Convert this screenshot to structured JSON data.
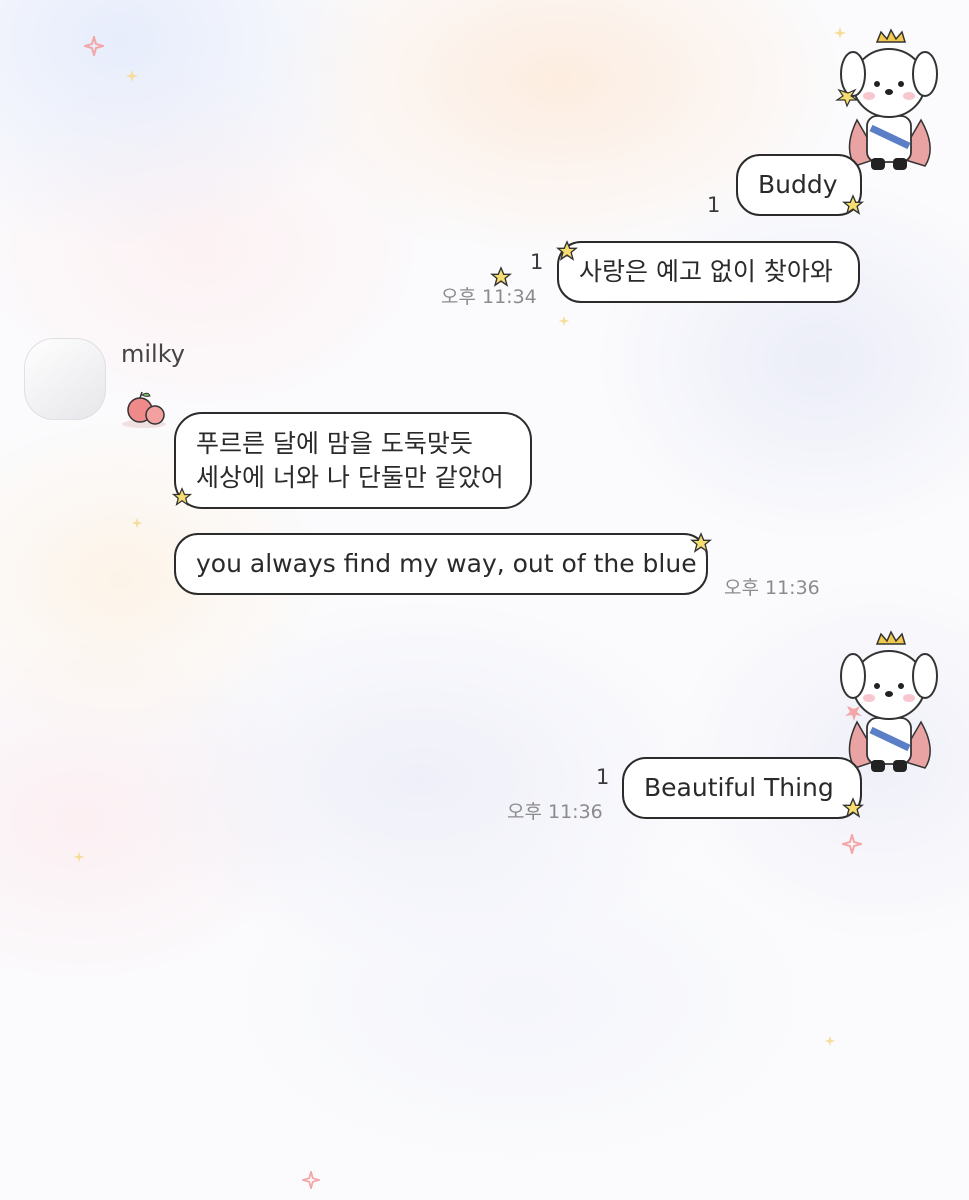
{
  "chat": {
    "messages": [
      {
        "id": "m1",
        "text": "Buddy",
        "unread": "1"
      },
      {
        "id": "m2",
        "text": "사랑은 예고 없이 찾아와",
        "unread": "1",
        "time": "오후 11:34"
      },
      {
        "id": "m3",
        "sender": "milky",
        "lines": [
          "푸르른 달에 맘을 도둑맞듯",
          "세상에 너와 나 단둘만 같았어"
        ]
      },
      {
        "id": "m4",
        "text": "you always find my way, out of the blue",
        "time": "오후 11:36"
      },
      {
        "id": "m5",
        "text": "Beautiful Thing",
        "unread": "1",
        "time": "오후 11:36"
      }
    ]
  },
  "colors": {
    "bubble_border": "#2b2b2b",
    "star_fill": "#f7dc6f",
    "sparkle": "#f2a6a6",
    "crown": "#f2c94c",
    "cape": "#e9a3a3"
  },
  "icons": {
    "sender_avatar": "avatar",
    "profile_sticker": "prince-puppy-icon",
    "apple_decoration": "apple-icon",
    "star_decoration": "star-icon"
  }
}
